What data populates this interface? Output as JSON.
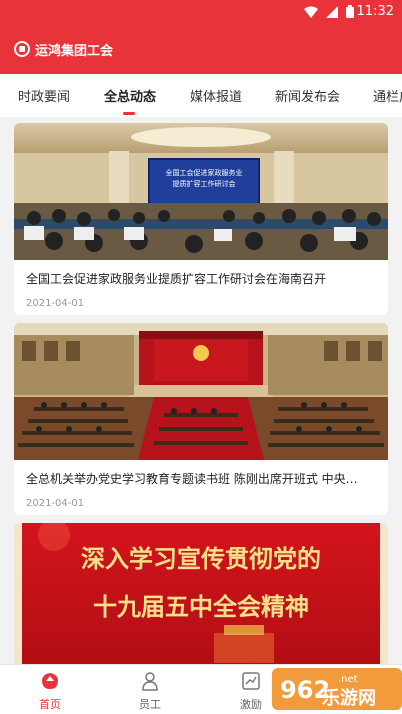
{
  "status_bar": {
    "time": "11:32"
  },
  "app": {
    "title": "运鸿集团工会"
  },
  "tabs": [
    {
      "label": "时政要闻",
      "active": false
    },
    {
      "label": "全总动态",
      "active": true
    },
    {
      "label": "媒体报道",
      "active": false
    },
    {
      "label": "新闻发布会",
      "active": false
    },
    {
      "label": "通栏广",
      "active": false
    }
  ],
  "news": [
    {
      "banner": {
        "line1": "全国工会促进家政服务业",
        "line2": "提质扩容工作研讨会"
      },
      "title": "全国工会促进家政服务业提质扩容工作研讨会在海南召开",
      "date": "2021-04-01"
    },
    {
      "title": "全总机关举办党史学习教育专题读书班 陈刚出席开班式 中央…",
      "date": "2021-04-01"
    },
    {
      "banner": {
        "line1": "深入学习宣传贯彻党的",
        "line2": "十九届五中全会精神"
      }
    }
  ],
  "bottom_nav": [
    {
      "label": "首页",
      "active": true,
      "icon": "home-icon"
    },
    {
      "label": "员工",
      "active": false,
      "icon": "person-icon"
    },
    {
      "label": "激励",
      "active": false,
      "icon": "chart-icon"
    }
  ],
  "watermark": {
    "text": "乐游网",
    "brand": "962.net"
  },
  "colors": {
    "primary": "#e8333a",
    "background": "#f2f2f2"
  }
}
